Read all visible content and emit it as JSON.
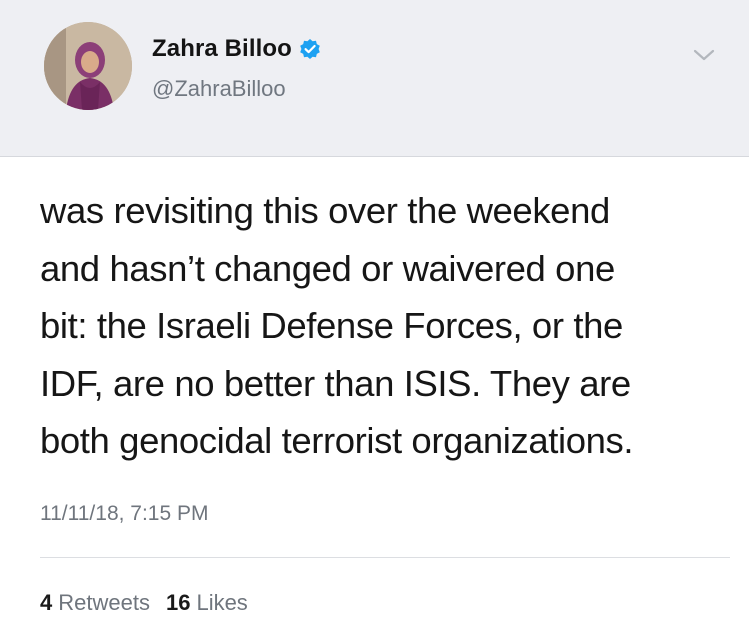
{
  "header": {
    "display_name": "Zahra Billoo",
    "handle": "@ZahraBilloo",
    "verified_icon": "verified-badge-icon",
    "menu_icon": "chevron-down-icon",
    "accent_color": "#1da1f2"
  },
  "tweet": {
    "lines": [
      "was revisiting this over the weekend",
      "and hasn’t changed or waivered one",
      "bit: the Israeli Defense Forces, or the",
      "IDF, are no better than ISIS. They are",
      "both genocidal terrorist organizations."
    ],
    "timestamp": "11/11/18, 7:15 PM"
  },
  "stats": {
    "retweets_count": "4",
    "retweets_label": "Retweets",
    "likes_count": "16",
    "likes_label": "Likes"
  }
}
